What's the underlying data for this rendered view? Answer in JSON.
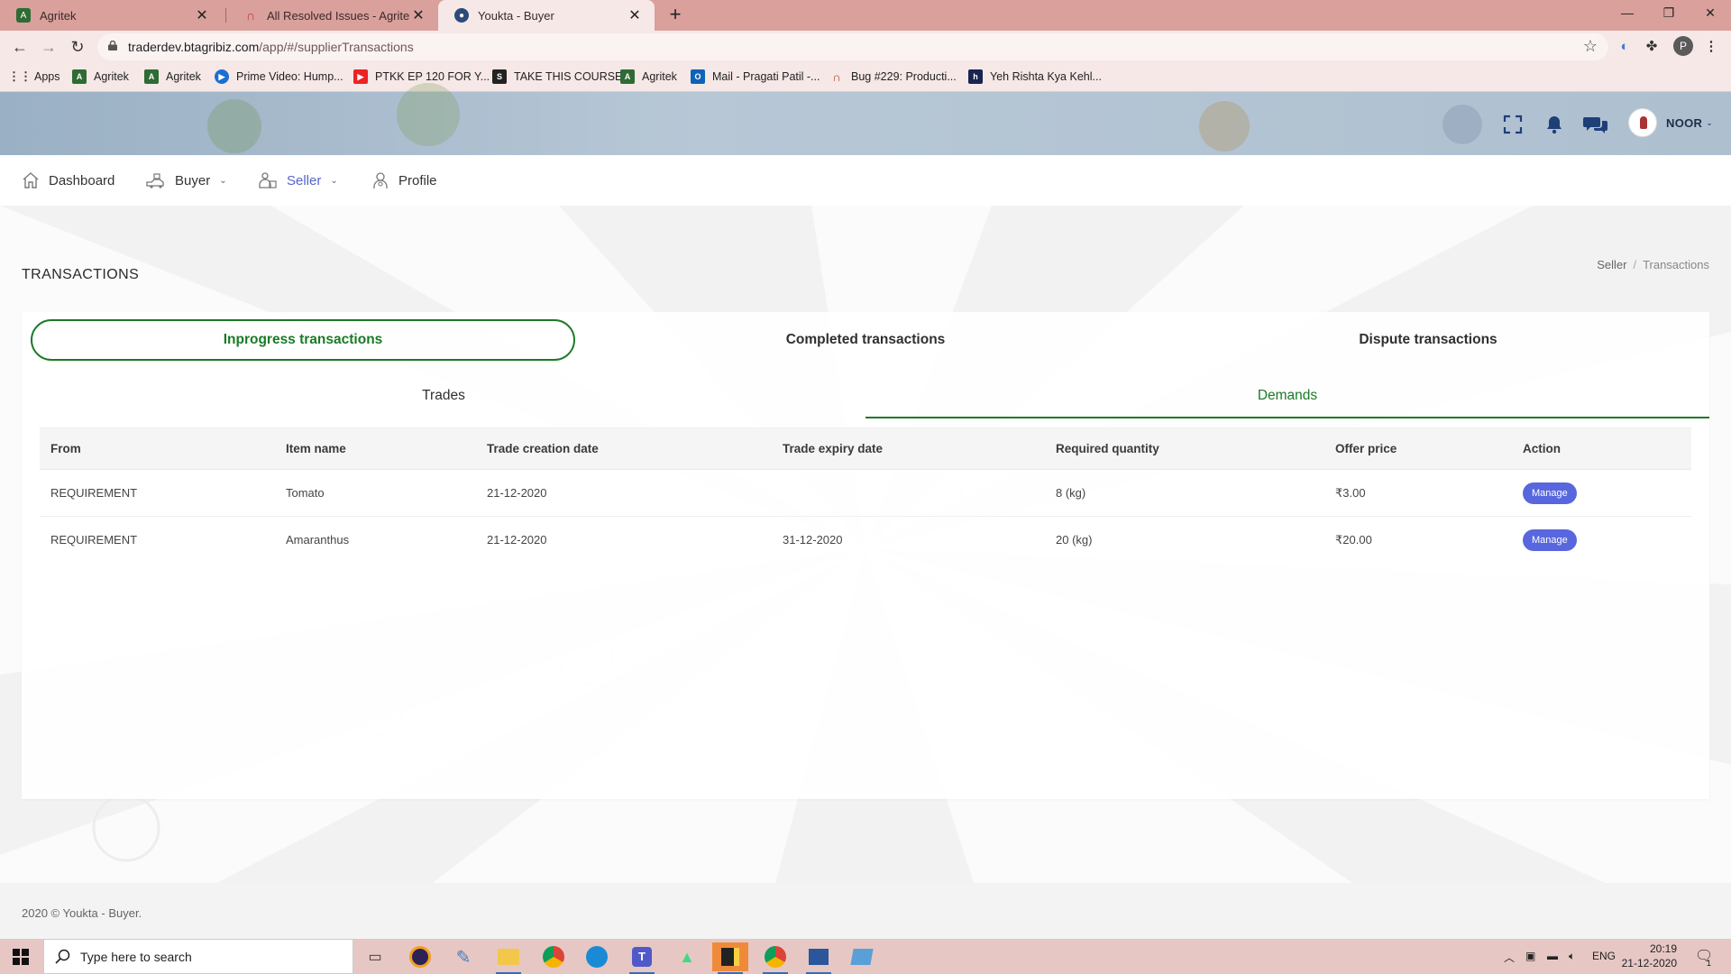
{
  "browser": {
    "tabs": [
      {
        "title": "Agritek",
        "active": false
      },
      {
        "title": "All Resolved Issues - Agritek - Re",
        "active": false
      },
      {
        "title": "Youkta - Buyer",
        "active": true
      }
    ],
    "url_host": "traderdev.btagribiz.com",
    "url_path": "/app/#/supplierTransactions",
    "profile_initial": "P",
    "bookmarks": [
      {
        "label": "Apps",
        "icon": "apps-grid-icon"
      },
      {
        "label": "Agritek",
        "icon": "agritek-icon"
      },
      {
        "label": "Agritek",
        "icon": "agritek-icon"
      },
      {
        "label": "Prime Video: Hump...",
        "icon": "prime-video-icon"
      },
      {
        "label": "PTKK EP 120 FOR Y...",
        "icon": "youtube-icon"
      },
      {
        "label": "TAKE THIS COURSE",
        "icon": "course-icon"
      },
      {
        "label": "Agritek",
        "icon": "agritek-icon"
      },
      {
        "label": "Mail - Pragati Patil -...",
        "icon": "outlook-icon"
      },
      {
        "label": "Bug #229: Producti...",
        "icon": "redmine-icon"
      },
      {
        "label": "Yeh Rishta Kya Kehl...",
        "icon": "video-icon"
      }
    ]
  },
  "header": {
    "user_name": "NOOR"
  },
  "menu": {
    "items": [
      {
        "label": "Dashboard",
        "icon": "home-icon"
      },
      {
        "label": "Buyer",
        "icon": "buyer-icon"
      },
      {
        "label": "Seller",
        "icon": "seller-icon"
      },
      {
        "label": "Profile",
        "icon": "profile-icon"
      }
    ]
  },
  "page": {
    "title": "TRANSACTIONS",
    "breadcrumb": [
      "Seller",
      "Transactions"
    ],
    "top_tabs": [
      "Inprogress transactions",
      "Completed transactions",
      "Dispute transactions"
    ],
    "sub_tabs": [
      "Trades",
      "Demands"
    ],
    "table": {
      "columns": [
        "From",
        "Item name",
        "Trade creation date",
        "Trade expiry date",
        "Required quantity",
        "Offer price",
        "Action"
      ],
      "rows": [
        {
          "from": "REQUIREMENT",
          "item": "Tomato",
          "created": "21-12-2020",
          "expiry": "",
          "quantity": "8 (kg)",
          "price": "₹3.00",
          "action": "Manage"
        },
        {
          "from": "REQUIREMENT",
          "item": "Amaranthus",
          "created": "21-12-2020",
          "expiry": "31-12-2020",
          "quantity": "20 (kg)",
          "price": "₹20.00",
          "action": "Manage"
        }
      ]
    }
  },
  "footer": {
    "text": "2020 © Youkta - Buyer."
  },
  "taskbar": {
    "search_placeholder": "Type here to search",
    "language": "ENG",
    "time": "20:19",
    "date": "21-12-2020",
    "notification_count": "1"
  },
  "colors": {
    "accent_green": "#1a7a26",
    "button_blue": "#5867dd",
    "seller_active": "#5765c8"
  }
}
